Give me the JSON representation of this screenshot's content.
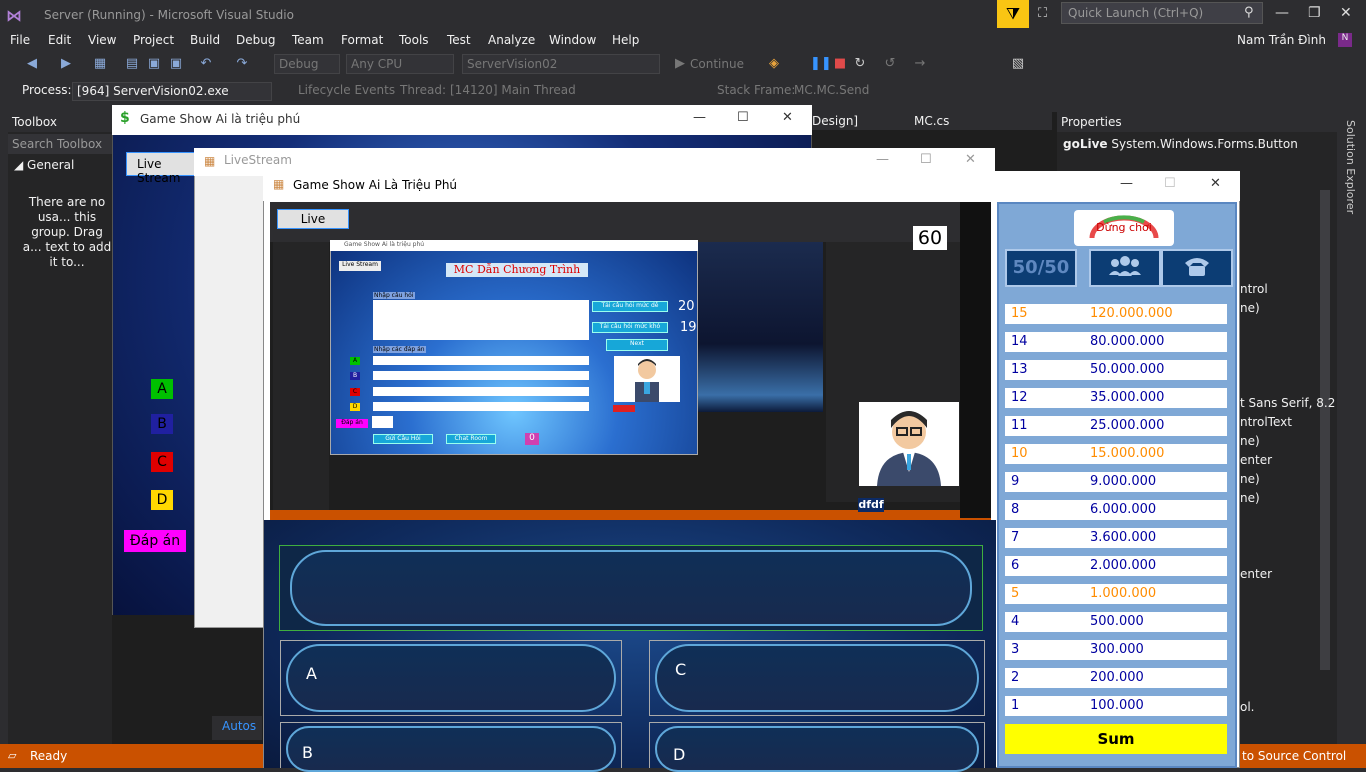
{
  "vs": {
    "title": "Server (Running) - Microsoft Visual Studio",
    "quick_launch": "Quick Launch (Ctrl+Q)",
    "user": "Nam Trần Đình",
    "menu": [
      "File",
      "Edit",
      "View",
      "Project",
      "Build",
      "Debug",
      "Team",
      "Format",
      "Tools",
      "Test",
      "Analyze",
      "Window",
      "Help"
    ],
    "toolbar": {
      "config": "Debug",
      "platform": "Any CPU",
      "project": "ServerVision02",
      "continue": "Continue"
    },
    "process_label": "Process:",
    "process": "[964] ServerVision02.exe",
    "lifecycle": "Lifecycle Events",
    "thread_label": "Thread:",
    "thread": "[14120] Main Thread",
    "stackframe_label": "Stack Frame:",
    "stackframe": "MC.MC.Send",
    "toolbox": {
      "title": "Toolbox",
      "search": "Search Toolbox",
      "group": "General",
      "empty_msg": "There are no usa... this group. Drag a... text to add it to..."
    },
    "tabs": [
      "Design]",
      "MC.cs"
    ],
    "properties": {
      "title": "Properties",
      "object": "goLive",
      "type": "System.Windows.Forms.Button",
      "fragments": [
        "ntrol",
        "ne)",
        "t Sans Serif, 8.2",
        "ntrolText",
        "ne)",
        "enter",
        "ne)",
        "ne)",
        "enter",
        "ol."
      ]
    },
    "solution_explorer": "Solution Explorer",
    "status": "Ready",
    "status_right": "to Source Control",
    "autos": "Autos"
  },
  "win1": {
    "title": "Game Show Ai là triệu phú",
    "live_button": "Live Stream",
    "answers": [
      "A",
      "B",
      "C",
      "D"
    ],
    "answer_colors": [
      "#00c000",
      "#2020a0",
      "#e00000",
      "#ffd800"
    ],
    "dapan": "Đáp án"
  },
  "win2": {
    "title": "LiveStream"
  },
  "win3": {
    "title": "Game Show Ai Là Triệu Phú",
    "live_button": "Live",
    "counter": "60",
    "stream_label": "dfdf",
    "inner": {
      "title": "Game Show Ai là triệu phú",
      "heading": "MC Dẫn Chương Trình",
      "live_button": "Live Stream",
      "q_label": "Nhập câu hỏi",
      "a_label": "Nhập các đáp án",
      "btn_easy": "Tải câu hỏi mức dễ",
      "btn_hard": "Tải câu hỏi mức khó",
      "btn_next": "Next",
      "n1": "20",
      "n2": "19",
      "send": "Gửi Câu Hỏi",
      "chat": "Chat Room",
      "zero": "0",
      "dapan": "Đáp án"
    },
    "answers": [
      "A",
      "C",
      "B",
      "D"
    ],
    "stop_button": "Dừng chơi",
    "lifeline_5050": "50/50",
    "prizes": [
      {
        "level": "15",
        "amount": "120.000.000",
        "milestone": true
      },
      {
        "level": "14",
        "amount": "80.000.000",
        "milestone": false
      },
      {
        "level": "13",
        "amount": "50.000.000",
        "milestone": false
      },
      {
        "level": "12",
        "amount": "35.000.000",
        "milestone": false
      },
      {
        "level": "11",
        "amount": "25.000.000",
        "milestone": false
      },
      {
        "level": "10",
        "amount": "15.000.000",
        "milestone": true
      },
      {
        "level": "9",
        "amount": "9.000.000",
        "milestone": false
      },
      {
        "level": "8",
        "amount": "6.000.000",
        "milestone": false
      },
      {
        "level": "7",
        "amount": "3.600.000",
        "milestone": false
      },
      {
        "level": "6",
        "amount": "2.000.000",
        "milestone": false
      },
      {
        "level": "5",
        "amount": "1.000.000",
        "milestone": true
      },
      {
        "level": "4",
        "amount": "500.000",
        "milestone": false
      },
      {
        "level": "3",
        "amount": "300.000",
        "milestone": false
      },
      {
        "level": "2",
        "amount": "200.000",
        "milestone": false
      },
      {
        "level": "1",
        "amount": "100.000",
        "milestone": false
      }
    ],
    "sum_button": "Sum",
    "milestone_color": "#ff8c00",
    "normal_color": "#0000a0"
  }
}
